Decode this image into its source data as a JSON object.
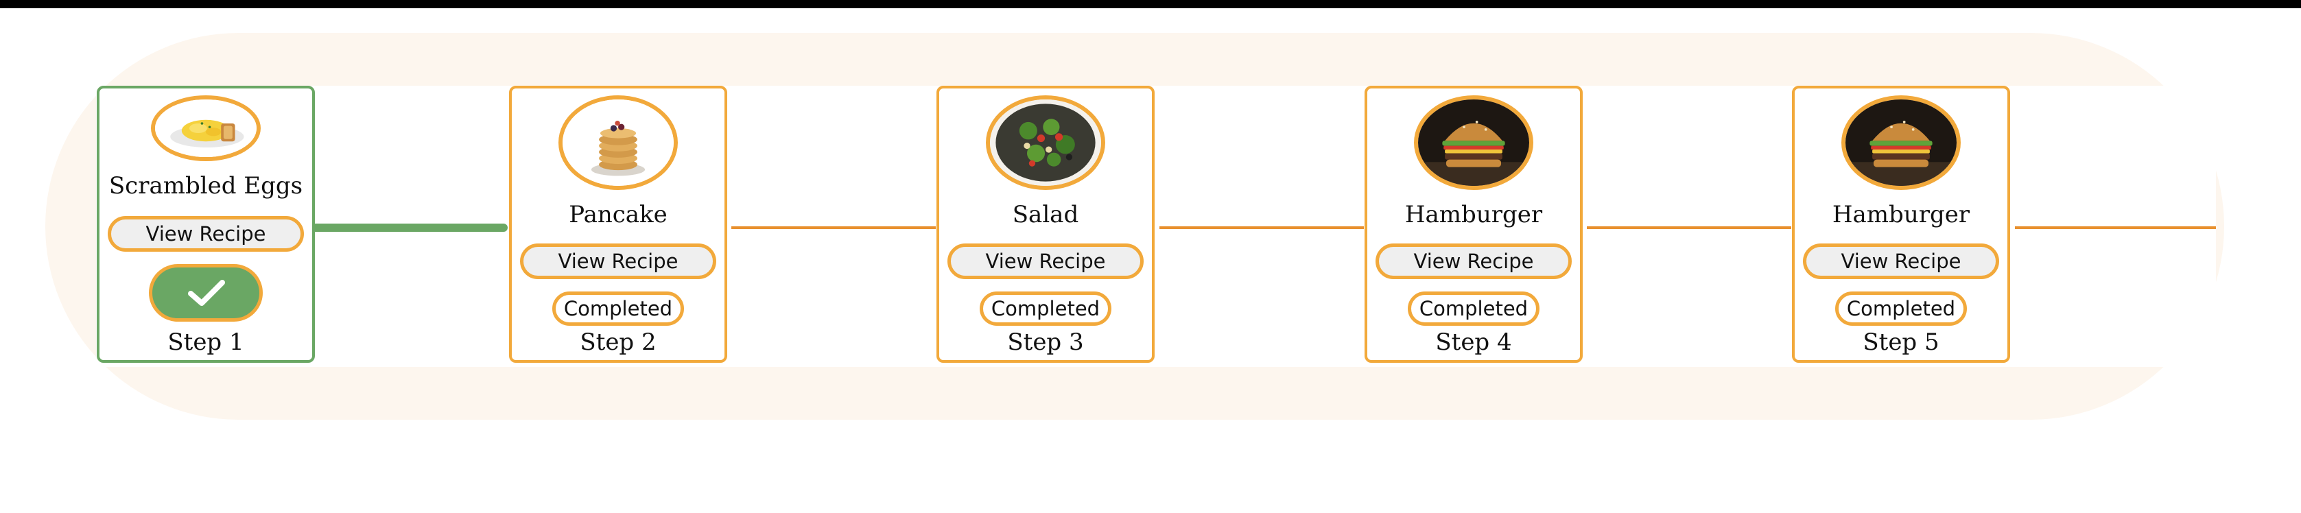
{
  "steps": [
    {
      "dish": "Scrambled Eggs",
      "view_label": "View Recipe",
      "status": "",
      "status_icon": "checkmark-icon",
      "step_label": "Step 1",
      "image": "scrambled-eggs-image",
      "completed": true
    },
    {
      "dish": "Pancake",
      "view_label": "View Recipe",
      "status": "Completed",
      "step_label": "Step 2",
      "image": "pancake-image",
      "completed": false
    },
    {
      "dish": "Salad",
      "view_label": "View Recipe",
      "status": "Completed",
      "step_label": "Step 3",
      "image": "salad-image",
      "completed": false
    },
    {
      "dish": "Hamburger",
      "view_label": "View Recipe",
      "status": "Completed",
      "step_label": "Step 4",
      "image": "hamburger-image",
      "completed": false
    },
    {
      "dish": "Hamburger",
      "view_label": "View Recipe",
      "status": "Completed",
      "step_label": "Step 5",
      "image": "hamburger-image",
      "completed": false
    }
  ],
  "colors": {
    "accent": "#f2a93b",
    "done": "#6aa764",
    "connector": "#e8902e",
    "background_pill": "#fdf6ee"
  }
}
